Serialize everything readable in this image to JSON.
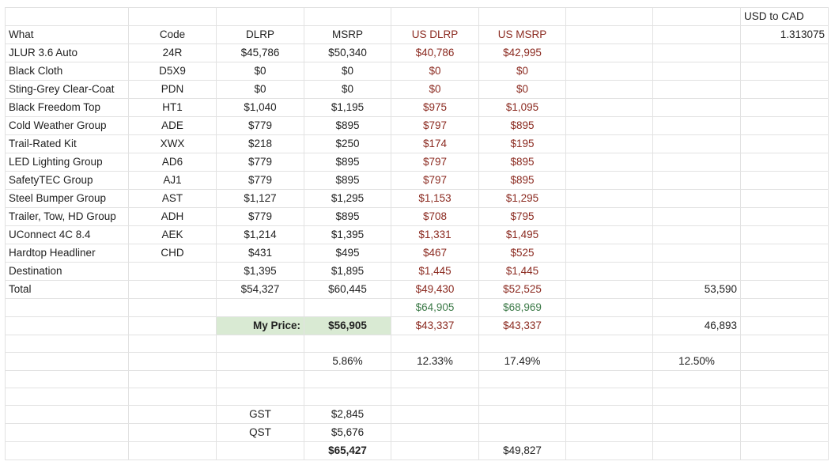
{
  "colors": {
    "us_text": "#8b2a20",
    "green_text": "#3c7a48",
    "highlight": "#d9ead3",
    "grid": "#e2e2e2"
  },
  "rows": [
    {
      "cells": [
        "",
        "",
        "",
        "",
        "",
        "",
        "",
        "",
        "USD to CAD"
      ]
    },
    {
      "cells": [
        "What",
        "Code",
        "DLRP",
        "MSRP",
        "US DLRP",
        "US MSRP",
        "",
        "",
        "1.313075"
      ]
    },
    {
      "cells": [
        "JLUR 3.6 Auto",
        "24R",
        "$45,786",
        "$50,340",
        "$40,786",
        "$42,995",
        "",
        "",
        ""
      ]
    },
    {
      "cells": [
        "Black Cloth",
        "D5X9",
        "$0",
        "$0",
        "$0",
        "$0",
        "",
        "",
        ""
      ]
    },
    {
      "cells": [
        "Sting-Grey Clear-Coat",
        "PDN",
        "$0",
        "$0",
        "$0",
        "$0",
        "",
        "",
        ""
      ]
    },
    {
      "cells": [
        "Black Freedom Top",
        "HT1",
        "$1,040",
        "$1,195",
        "$975",
        "$1,095",
        "",
        "",
        ""
      ]
    },
    {
      "cells": [
        "Cold Weather Group",
        "ADE",
        "$779",
        "$895",
        "$797",
        "$895",
        "",
        "",
        ""
      ]
    },
    {
      "cells": [
        "Trail-Rated Kit",
        "XWX",
        "$218",
        "$250",
        "$174",
        "$195",
        "",
        "",
        ""
      ]
    },
    {
      "cells": [
        "LED Lighting Group",
        "AD6",
        "$779",
        "$895",
        "$797",
        "$895",
        "",
        "",
        ""
      ]
    },
    {
      "cells": [
        "SafetyTEC Group",
        "AJ1",
        "$779",
        "$895",
        "$797",
        "$895",
        "",
        "",
        ""
      ]
    },
    {
      "cells": [
        "Steel Bumper Group",
        "AST",
        "$1,127",
        "$1,295",
        "$1,153",
        "$1,295",
        "",
        "",
        ""
      ]
    },
    {
      "cells": [
        "Trailer, Tow, HD Group",
        "ADH",
        "$779",
        "$895",
        "$708",
        "$795",
        "",
        "",
        ""
      ]
    },
    {
      "cells": [
        "UConnect 4C 8.4",
        "AEK",
        "$1,214",
        "$1,395",
        "$1,331",
        "$1,495",
        "",
        "",
        ""
      ]
    },
    {
      "cells": [
        "Hardtop Headliner",
        "CHD",
        "$431",
        "$495",
        "$467",
        "$525",
        "",
        "",
        ""
      ]
    },
    {
      "cells": [
        "Destination",
        "",
        "$1,395",
        "$1,895",
        "$1,445",
        "$1,445",
        "",
        "",
        ""
      ]
    },
    {
      "cells": [
        "Total",
        "",
        "$54,327",
        "$60,445",
        "$49,430",
        "$52,525",
        "",
        "53,590",
        ""
      ]
    },
    {
      "cells": [
        "",
        "",
        "",
        "",
        "$64,905",
        "$68,969",
        "",
        "",
        ""
      ]
    },
    {
      "cells": [
        "",
        "",
        "My Price:",
        "$56,905",
        "$43,337",
        "$43,337",
        "",
        "46,893",
        ""
      ]
    },
    {
      "cells": [
        "",
        "",
        "",
        "",
        "",
        "",
        "",
        "",
        ""
      ]
    },
    {
      "cells": [
        "",
        "",
        "",
        "5.86%",
        "12.33%",
        "17.49%",
        "",
        "12.50%",
        ""
      ]
    },
    {
      "cells": [
        "",
        "",
        "",
        "",
        "",
        "",
        "",
        "",
        ""
      ]
    },
    {
      "cells": [
        "",
        "",
        "",
        "",
        "",
        "",
        "",
        "",
        ""
      ]
    },
    {
      "cells": [
        "",
        "",
        "GST",
        "$2,845",
        "",
        "",
        "",
        "",
        ""
      ]
    },
    {
      "cells": [
        "",
        "",
        "QST",
        "$5,676",
        "",
        "",
        "",
        "",
        ""
      ]
    },
    {
      "cells": [
        "",
        "",
        "",
        "$65,427",
        "",
        "$49,827",
        "",
        "",
        ""
      ]
    }
  ]
}
